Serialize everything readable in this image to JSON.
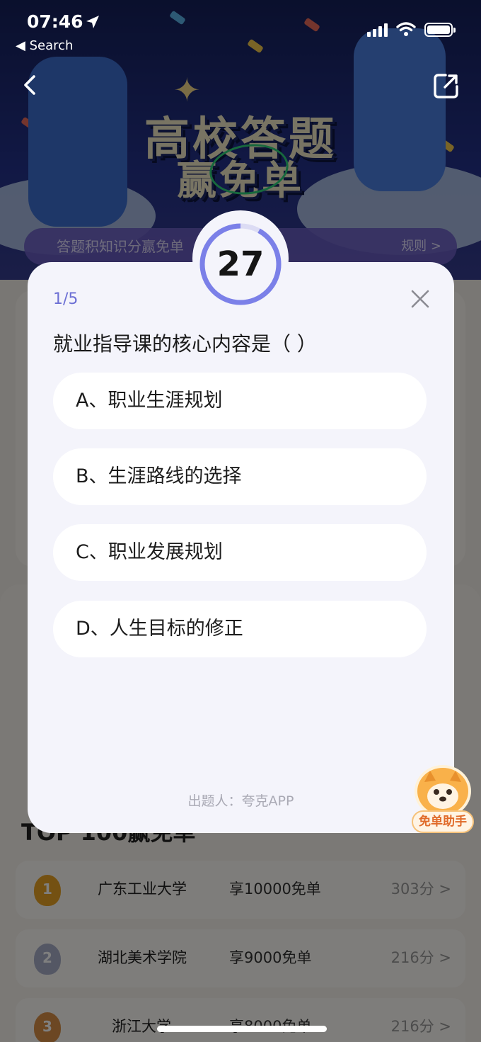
{
  "status_bar": {
    "time": "07:46",
    "back_app": "◀ Search"
  },
  "background": {
    "headline_line1": "高校答题",
    "headline_line2": "赢免单",
    "strip_text": "答题积知识分赢免单",
    "rules_link": "规则 >",
    "section_title": "TOP 100赢免单",
    "ranking": [
      {
        "rank": "1",
        "school": "广东工业大学",
        "reward": "享10000免单",
        "score": "303分 >"
      },
      {
        "rank": "2",
        "school": "湖北美术学院",
        "reward": "享9000免单",
        "score": "216分 >"
      },
      {
        "rank": "3",
        "school": "浙江大学",
        "reward": "享8000免单",
        "score": "216分 >"
      }
    ]
  },
  "quiz": {
    "timer": "27",
    "timer_fraction_remaining": 0.92,
    "progress": "1/5",
    "question": "就业指导课的核心内容是（ ）",
    "options": [
      "A、职业生涯规划",
      "B、生涯路线的选择",
      "C、职业发展规划",
      "D、人生目标的修正"
    ],
    "author": "出题人：夸克APP",
    "helper_label": "免单助手"
  },
  "colors": {
    "accent": "#7b80e8",
    "timer_track": "#dcdcf4",
    "modal_bg": "#f4f4fb"
  }
}
